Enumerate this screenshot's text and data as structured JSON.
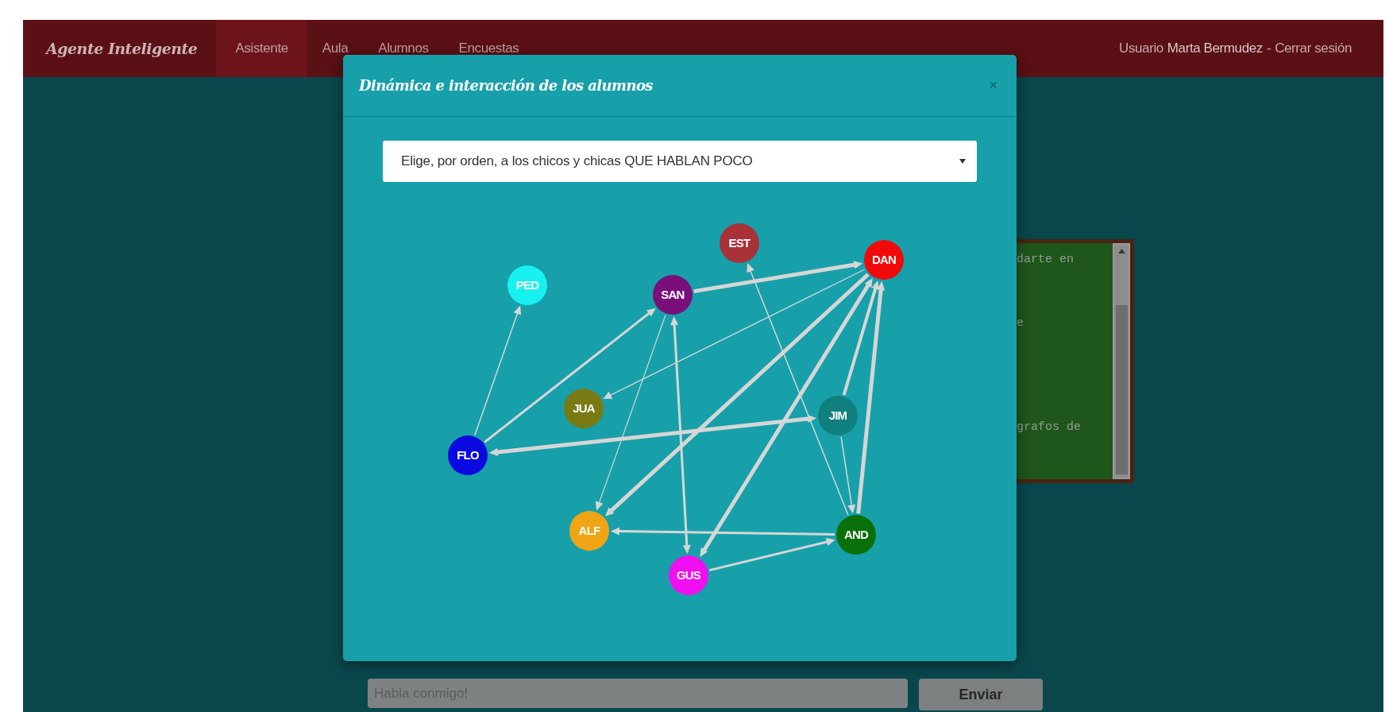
{
  "navbar": {
    "brand": "Agente Inteligente",
    "items": [
      {
        "label": "Asistente",
        "selected": true
      },
      {
        "label": "Aula",
        "selected": false
      },
      {
        "label": "Alumnos",
        "selected": false
      },
      {
        "label": "Encuestas",
        "selected": false
      }
    ],
    "user": {
      "prefix": "Usuario",
      "name": "Marta Bermudez",
      "separator": "-",
      "logout": "Cerrar sesión"
    }
  },
  "board": {
    "lines": [
      "darte en",
      "e",
      "grafos de"
    ]
  },
  "chat": {
    "placeholder": "Habla conmigo!",
    "send": "Enviar"
  },
  "modal": {
    "title": "Dinámica e interacción de los alumnos",
    "close": "×",
    "select": {
      "value": "Elige, por orden, a los chicos y chicas QUE HABLAN POCO"
    },
    "nodes": [
      {
        "label": "EST",
        "color": "#a83238"
      },
      {
        "label": "DAN",
        "color": "#f00a0a"
      },
      {
        "label": "PED",
        "color": "#19f0f0"
      },
      {
        "label": "SAN",
        "color": "#7a0f7a"
      },
      {
        "label": "JUA",
        "color": "#7a7a14"
      },
      {
        "label": "JIM",
        "color": "#10807f"
      },
      {
        "label": "FLO",
        "color": "#0a0ae0"
      },
      {
        "label": "ALF",
        "color": "#f0a514"
      },
      {
        "label": "AND",
        "color": "#0a700a"
      },
      {
        "label": "GUS",
        "color": "#f00ff0"
      }
    ]
  }
}
